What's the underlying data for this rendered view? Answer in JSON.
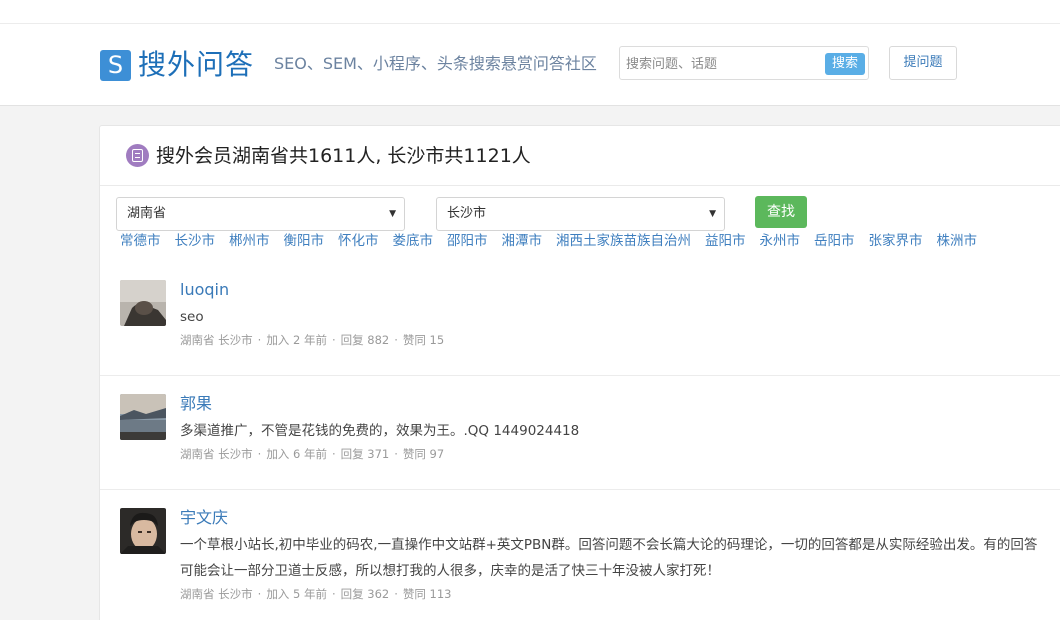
{
  "header": {
    "logo_mark": "S",
    "logo_text": "搜外问答",
    "tagline": "SEO、SEM、小程序、头条搜索悬赏问答社区",
    "search_placeholder": "搜索问题、话题",
    "search_button": "搜索",
    "ask_button": "提问题"
  },
  "panel": {
    "title": "搜外会员湖南省共1611人, 长沙市共1121人",
    "province_select": "湖南省",
    "city_select": "长沙市",
    "find_button": "查找",
    "cities": [
      "常德市",
      "长沙市",
      "郴州市",
      "衡阳市",
      "怀化市",
      "娄底市",
      "邵阳市",
      "湘潭市",
      "湘西土家族苗族自治州",
      "益阳市",
      "永州市",
      "岳阳市",
      "张家界市",
      "株洲市"
    ]
  },
  "members": [
    {
      "name": "luoqin",
      "description": "seo",
      "location": "湖南省 长沙市",
      "joined": "加入 2 年前",
      "replies": "回复 882",
      "likes": "赞同 15"
    },
    {
      "name": "郭果",
      "description": "多渠道推广，不管是花钱的免费的，效果为王。.QQ 1449024418",
      "location": "湖南省 长沙市",
      "joined": "加入 6 年前",
      "replies": "回复 371",
      "likes": "赞同 97"
    },
    {
      "name": "宇文庆",
      "description": "一个草根小站长,初中毕业的码农,一直操作中文站群+英文PBN群。回答问题不会长篇大论的码理论，一切的回答都是从实际经验出发。有的回答可能会让一部分卫道士反感，所以想打我的人很多，庆幸的是活了快三十年没被人家打死！",
      "location": "湖南省 长沙市",
      "joined": "加入 5 年前",
      "replies": "回复 362",
      "likes": "赞同 113"
    }
  ],
  "colors": {
    "brand": "#3d8fd6",
    "link": "#3a7ab8",
    "find_button": "#5cb85c",
    "search_button": "#5aaee6"
  }
}
